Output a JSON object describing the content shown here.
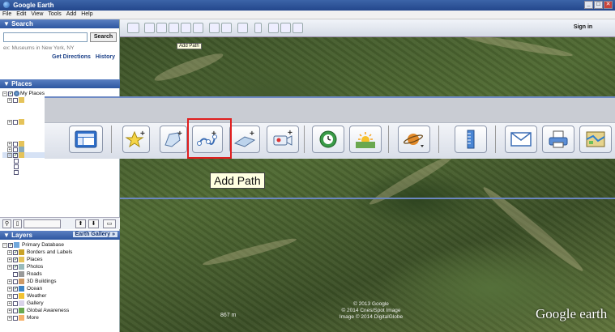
{
  "window": {
    "title": "Google Earth"
  },
  "menu": [
    "File",
    "Edit",
    "View",
    "Tools",
    "Add",
    "Help"
  ],
  "search": {
    "header": "▼ Search",
    "button": "Search",
    "hint": "ex: Museums in New York, NY",
    "directions": "Get Directions",
    "history": "History"
  },
  "places": {
    "header": "▼ Places",
    "items": [
      "My Places"
    ]
  },
  "layers": {
    "header": "▼ Layers",
    "gallery": "Earth Gallery »",
    "items": [
      "Primary Database",
      "Borders and Labels",
      "Places",
      "Photos",
      "Roads",
      "3D Buildings",
      "Ocean",
      "Weather",
      "Gallery",
      "Global Awareness",
      "More"
    ]
  },
  "topbar": {
    "signin": "Sign in",
    "mini_tooltip": "Add Path"
  },
  "tooltip": "Add Path",
  "map": {
    "scale": "867 m",
    "credits": [
      "© 2013 Google",
      "© 2014 Cnes/Spot Image",
      "Image © 2014 DigitalGlobe"
    ],
    "brand": "Google earth"
  }
}
